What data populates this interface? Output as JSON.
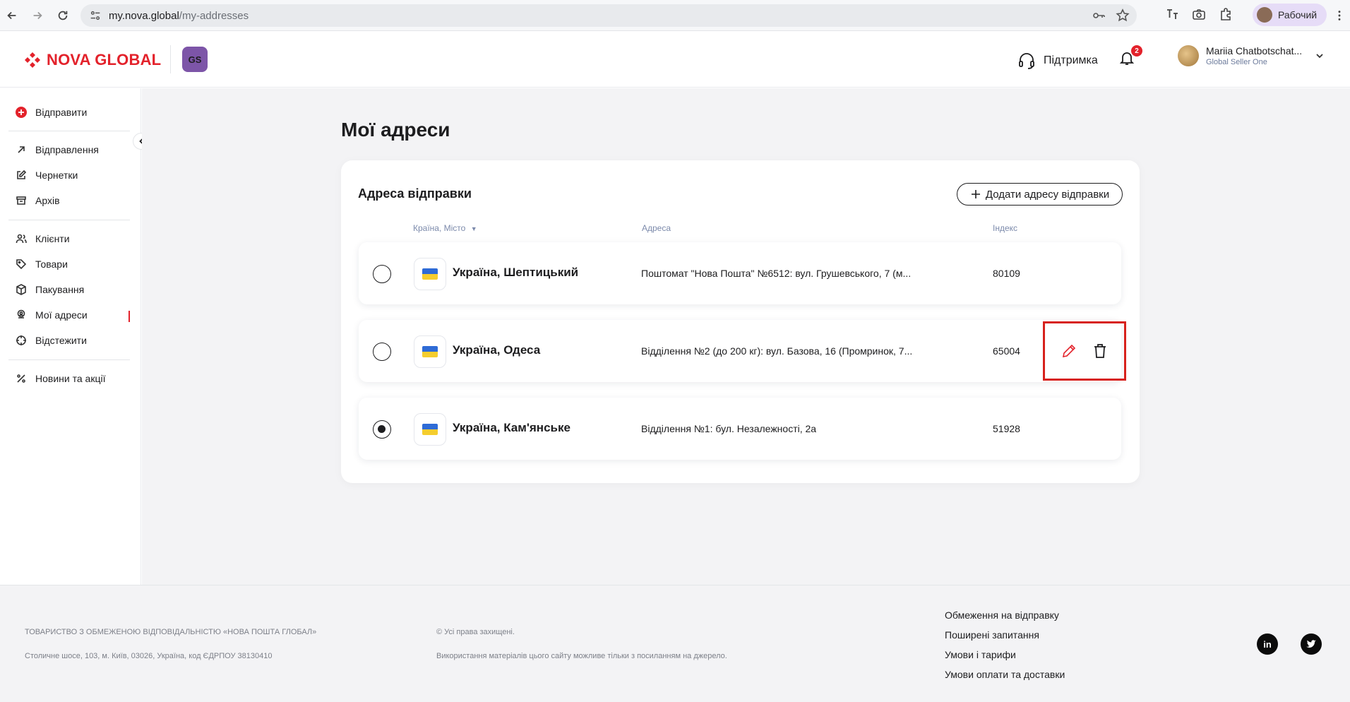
{
  "browser": {
    "url_host": "my.nova.global",
    "url_path": "/my-addresses",
    "profile_label": "Рабочий"
  },
  "header": {
    "logo_text": "NOVA GLOBAL",
    "badge_text": "GS",
    "support_label": "Підтримка",
    "notifications_count": "2",
    "user_name": "Mariia Chatbotschat...",
    "user_role": "Global Seller One"
  },
  "sidebar": {
    "send": "Відправити",
    "items": [
      {
        "label": "Відправлення",
        "icon": "arrow-up-right-icon"
      },
      {
        "label": "Чернетки",
        "icon": "edit-icon"
      },
      {
        "label": "Архів",
        "icon": "archive-icon"
      }
    ],
    "items2": [
      {
        "label": "Клієнти",
        "icon": "users-icon"
      },
      {
        "label": "Товари",
        "icon": "tag-icon"
      },
      {
        "label": "Пакування",
        "icon": "box-icon"
      },
      {
        "label": "Мої адреси",
        "icon": "location-user-icon",
        "active": true
      },
      {
        "label": "Відстежити",
        "icon": "crosshair-icon"
      }
    ],
    "news": "Новини та акції"
  },
  "main": {
    "title": "Мої адреси",
    "section_title": "Адреса відправки",
    "add_button": "Додати адресу відправки",
    "columns": {
      "country_city": "Країна, Місто",
      "address": "Адреса",
      "index": "Індекс"
    },
    "addresses": [
      {
        "city": "Україна, Шептицький",
        "address": "Поштомат \"Нова Пошта\" №6512: вул. Грушевського, 7 (м...",
        "index": "80109",
        "selected": false
      },
      {
        "city": "Україна, Одеса",
        "address": "Відділення №2 (до 200 кг): вул. Базова, 16 (Промринок, 7...",
        "index": "65004",
        "selected": false
      },
      {
        "city": "Україна, Кам'янське",
        "address": "Відділення №1: бул. Незалежності, 2а",
        "index": "51928",
        "selected": true
      }
    ]
  },
  "footer": {
    "company": "ТОВАРИСТВО З ОБМЕЖЕНОЮ ВІДПОВІДАЛЬНІСТЮ «НОВА ПОШТА ГЛОБАЛ»",
    "address": "Столичне шосе, 103, м. Київ, 03026, Україна, код ЄДРПОУ 38130410",
    "rights": "© Усі права захищені.",
    "usage": "Використання матеріалів цього сайту можливе тільки з посиланням на джерело.",
    "links": [
      "Обмеження на відправку",
      "Поширені запитання",
      "Умови і тарифи",
      "Умови оплати та доставки"
    ]
  },
  "colors": {
    "brand_red": "#e3222b",
    "highlight_box": "#d7211c",
    "accent_purple": "#7d55a8"
  }
}
